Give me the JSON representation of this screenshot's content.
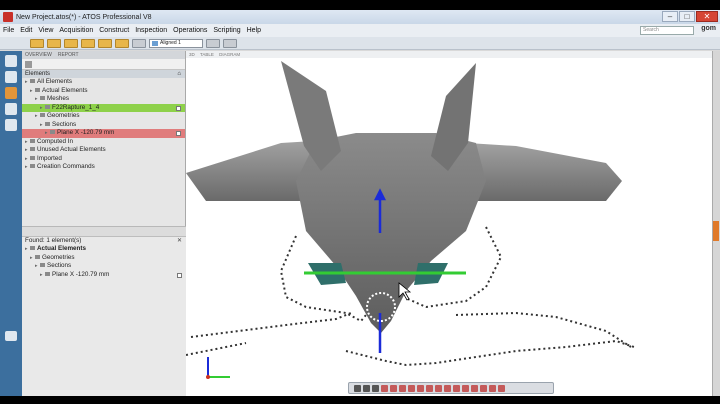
{
  "window": {
    "title": "New Project.atos(*) - ATOS Professional V8",
    "buttons": [
      "–",
      "□",
      "✕"
    ]
  },
  "menu": {
    "items": [
      "File",
      "Edit",
      "View",
      "Acquisition",
      "Construct",
      "Inspection",
      "Operations",
      "Scripting",
      "Help"
    ],
    "search_placeholder": "Search",
    "brand": "gom"
  },
  "toolbar": {
    "alignment_value": "Aligned 1"
  },
  "explorer": {
    "tabs": [
      "OVERVIEW",
      "REPORT"
    ],
    "header": "Elements",
    "tree": [
      {
        "label": "All Elements",
        "indent": 0,
        "state": "normal"
      },
      {
        "label": "Actual Elements",
        "indent": 1,
        "state": "normal"
      },
      {
        "label": "Meshes",
        "indent": 2,
        "state": "normal"
      },
      {
        "label": "F22Rapture_1_4",
        "indent": 3,
        "state": "selected-green"
      },
      {
        "label": "Geometries",
        "indent": 2,
        "state": "normal"
      },
      {
        "label": "Sections",
        "indent": 3,
        "state": "normal"
      },
      {
        "label": "Plane X -120.79 mm",
        "indent": 4,
        "state": "selected-red"
      },
      {
        "label": "Computed In",
        "indent": 0,
        "state": "normal"
      },
      {
        "label": "Unused Actual Elements",
        "indent": 0,
        "state": "normal"
      },
      {
        "label": "Imported",
        "indent": 0,
        "state": "normal"
      },
      {
        "label": "Creation Commands",
        "indent": 0,
        "state": "normal"
      }
    ],
    "found_text": "Found: 1 element(s)",
    "found_tree": [
      {
        "label": "Actual Elements",
        "indent": 0,
        "bold": true
      },
      {
        "label": "Geometries",
        "indent": 1
      },
      {
        "label": "Sections",
        "indent": 2
      },
      {
        "label": "Plane X -120.79 mm",
        "indent": 3
      }
    ]
  },
  "viewport": {
    "tabs": [
      "3D",
      "TABLE",
      "DIAGRAM"
    ]
  },
  "colors": {
    "accent_green": "#8ed14a",
    "accent_red": "#e07c7c",
    "axis_blue": "#1b2bd8",
    "section_green": "#33cc33",
    "strip_blue": "#3c6f9e"
  }
}
